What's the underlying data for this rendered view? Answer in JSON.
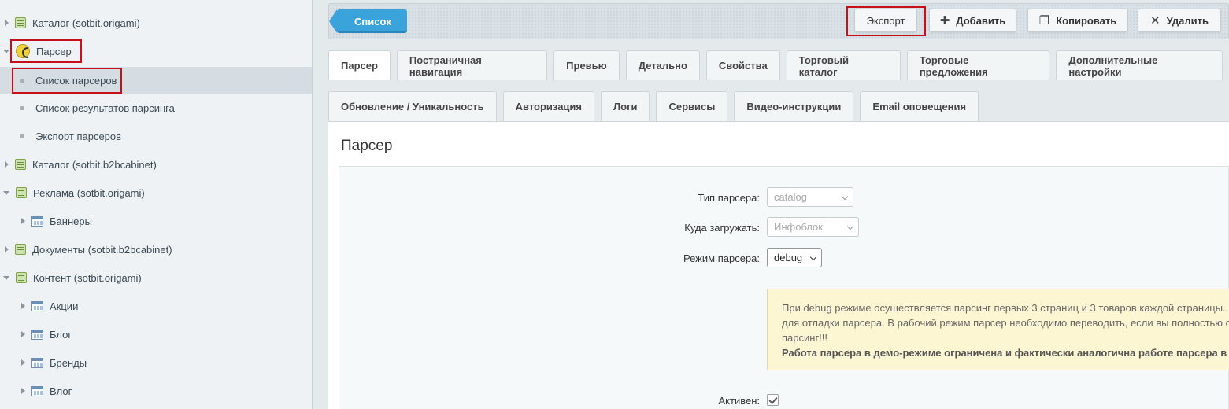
{
  "sidebar": {
    "items": [
      {
        "label": "Каталог (sotbit.origami)"
      },
      {
        "label": "Парсер"
      },
      {
        "label": "Список парсеров"
      },
      {
        "label": "Список результатов парсинга"
      },
      {
        "label": "Экспорт парсеров"
      },
      {
        "label": "Каталог (sotbit.b2bcabinet)"
      },
      {
        "label": "Реклама (sotbit.origami)"
      },
      {
        "label": "Баннеры"
      },
      {
        "label": "Документы (sotbit.b2bcabinet)"
      },
      {
        "label": "Контент (sotbit.origami)"
      },
      {
        "label": "Акции"
      },
      {
        "label": "Блог"
      },
      {
        "label": "Бренды"
      },
      {
        "label": "Влог"
      }
    ]
  },
  "toolbar": {
    "list_label": "Список",
    "export_label": "Экспорт",
    "add_label": "Добавить",
    "copy_label": "Копировать",
    "delete_label": "Удалить"
  },
  "tabs_row1": [
    "Парсер",
    "Постраничная навигация",
    "Превью",
    "Детально",
    "Свойства",
    "Торговый каталог",
    "Торговые предложения",
    "Дополнительные настройки"
  ],
  "tabs_row2": [
    "Обновление / Уникальность",
    "Авторизация",
    "Логи",
    "Сервисы",
    "Видео-инструкции",
    "Email оповещения"
  ],
  "form": {
    "title": "Парсер",
    "parser_type_label": "Тип парсера:",
    "parser_type_value": "catalog",
    "load_to_label": "Куда загружать:",
    "load_to_value": "Инфоблок",
    "mode_label": "Режим парсера:",
    "mode_value": "debug",
    "note_line1": "При debug режиме осуществляется парсинг первых 3 страниц и 3 товаров каждой страницы.",
    "note_line2": "для отладки парсера. В рабочий режим парсер необходимо переводить, если вы полностью с",
    "note_line3": "парсинг!!!",
    "note_bold": "Работа парсера в демо-режиме ограничена и фактически аналогична работе парсера в",
    "active_label": "Активен:"
  },
  "colors": {
    "accent": "#3aa3dc",
    "highlight": "#c8101a",
    "note_bg": "#fdf6d3"
  }
}
